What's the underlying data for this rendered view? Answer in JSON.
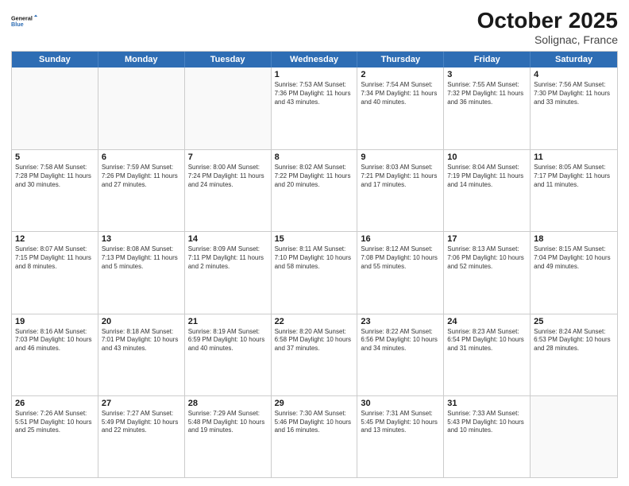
{
  "header": {
    "logo_line1": "General",
    "logo_line2": "Blue",
    "month": "October 2025",
    "location": "Solignac, France"
  },
  "days_of_week": [
    "Sunday",
    "Monday",
    "Tuesday",
    "Wednesday",
    "Thursday",
    "Friday",
    "Saturday"
  ],
  "weeks": [
    [
      {
        "day": "",
        "info": ""
      },
      {
        "day": "",
        "info": ""
      },
      {
        "day": "",
        "info": ""
      },
      {
        "day": "1",
        "info": "Sunrise: 7:53 AM\nSunset: 7:36 PM\nDaylight: 11 hours\nand 43 minutes."
      },
      {
        "day": "2",
        "info": "Sunrise: 7:54 AM\nSunset: 7:34 PM\nDaylight: 11 hours\nand 40 minutes."
      },
      {
        "day": "3",
        "info": "Sunrise: 7:55 AM\nSunset: 7:32 PM\nDaylight: 11 hours\nand 36 minutes."
      },
      {
        "day": "4",
        "info": "Sunrise: 7:56 AM\nSunset: 7:30 PM\nDaylight: 11 hours\nand 33 minutes."
      }
    ],
    [
      {
        "day": "5",
        "info": "Sunrise: 7:58 AM\nSunset: 7:28 PM\nDaylight: 11 hours\nand 30 minutes."
      },
      {
        "day": "6",
        "info": "Sunrise: 7:59 AM\nSunset: 7:26 PM\nDaylight: 11 hours\nand 27 minutes."
      },
      {
        "day": "7",
        "info": "Sunrise: 8:00 AM\nSunset: 7:24 PM\nDaylight: 11 hours\nand 24 minutes."
      },
      {
        "day": "8",
        "info": "Sunrise: 8:02 AM\nSunset: 7:22 PM\nDaylight: 11 hours\nand 20 minutes."
      },
      {
        "day": "9",
        "info": "Sunrise: 8:03 AM\nSunset: 7:21 PM\nDaylight: 11 hours\nand 17 minutes."
      },
      {
        "day": "10",
        "info": "Sunrise: 8:04 AM\nSunset: 7:19 PM\nDaylight: 11 hours\nand 14 minutes."
      },
      {
        "day": "11",
        "info": "Sunrise: 8:05 AM\nSunset: 7:17 PM\nDaylight: 11 hours\nand 11 minutes."
      }
    ],
    [
      {
        "day": "12",
        "info": "Sunrise: 8:07 AM\nSunset: 7:15 PM\nDaylight: 11 hours\nand 8 minutes."
      },
      {
        "day": "13",
        "info": "Sunrise: 8:08 AM\nSunset: 7:13 PM\nDaylight: 11 hours\nand 5 minutes."
      },
      {
        "day": "14",
        "info": "Sunrise: 8:09 AM\nSunset: 7:11 PM\nDaylight: 11 hours\nand 2 minutes."
      },
      {
        "day": "15",
        "info": "Sunrise: 8:11 AM\nSunset: 7:10 PM\nDaylight: 10 hours\nand 58 minutes."
      },
      {
        "day": "16",
        "info": "Sunrise: 8:12 AM\nSunset: 7:08 PM\nDaylight: 10 hours\nand 55 minutes."
      },
      {
        "day": "17",
        "info": "Sunrise: 8:13 AM\nSunset: 7:06 PM\nDaylight: 10 hours\nand 52 minutes."
      },
      {
        "day": "18",
        "info": "Sunrise: 8:15 AM\nSunset: 7:04 PM\nDaylight: 10 hours\nand 49 minutes."
      }
    ],
    [
      {
        "day": "19",
        "info": "Sunrise: 8:16 AM\nSunset: 7:03 PM\nDaylight: 10 hours\nand 46 minutes."
      },
      {
        "day": "20",
        "info": "Sunrise: 8:18 AM\nSunset: 7:01 PM\nDaylight: 10 hours\nand 43 minutes."
      },
      {
        "day": "21",
        "info": "Sunrise: 8:19 AM\nSunset: 6:59 PM\nDaylight: 10 hours\nand 40 minutes."
      },
      {
        "day": "22",
        "info": "Sunrise: 8:20 AM\nSunset: 6:58 PM\nDaylight: 10 hours\nand 37 minutes."
      },
      {
        "day": "23",
        "info": "Sunrise: 8:22 AM\nSunset: 6:56 PM\nDaylight: 10 hours\nand 34 minutes."
      },
      {
        "day": "24",
        "info": "Sunrise: 8:23 AM\nSunset: 6:54 PM\nDaylight: 10 hours\nand 31 minutes."
      },
      {
        "day": "25",
        "info": "Sunrise: 8:24 AM\nSunset: 6:53 PM\nDaylight: 10 hours\nand 28 minutes."
      }
    ],
    [
      {
        "day": "26",
        "info": "Sunrise: 7:26 AM\nSunset: 5:51 PM\nDaylight: 10 hours\nand 25 minutes."
      },
      {
        "day": "27",
        "info": "Sunrise: 7:27 AM\nSunset: 5:49 PM\nDaylight: 10 hours\nand 22 minutes."
      },
      {
        "day": "28",
        "info": "Sunrise: 7:29 AM\nSunset: 5:48 PM\nDaylight: 10 hours\nand 19 minutes."
      },
      {
        "day": "29",
        "info": "Sunrise: 7:30 AM\nSunset: 5:46 PM\nDaylight: 10 hours\nand 16 minutes."
      },
      {
        "day": "30",
        "info": "Sunrise: 7:31 AM\nSunset: 5:45 PM\nDaylight: 10 hours\nand 13 minutes."
      },
      {
        "day": "31",
        "info": "Sunrise: 7:33 AM\nSunset: 5:43 PM\nDaylight: 10 hours\nand 10 minutes."
      },
      {
        "day": "",
        "info": ""
      }
    ]
  ]
}
